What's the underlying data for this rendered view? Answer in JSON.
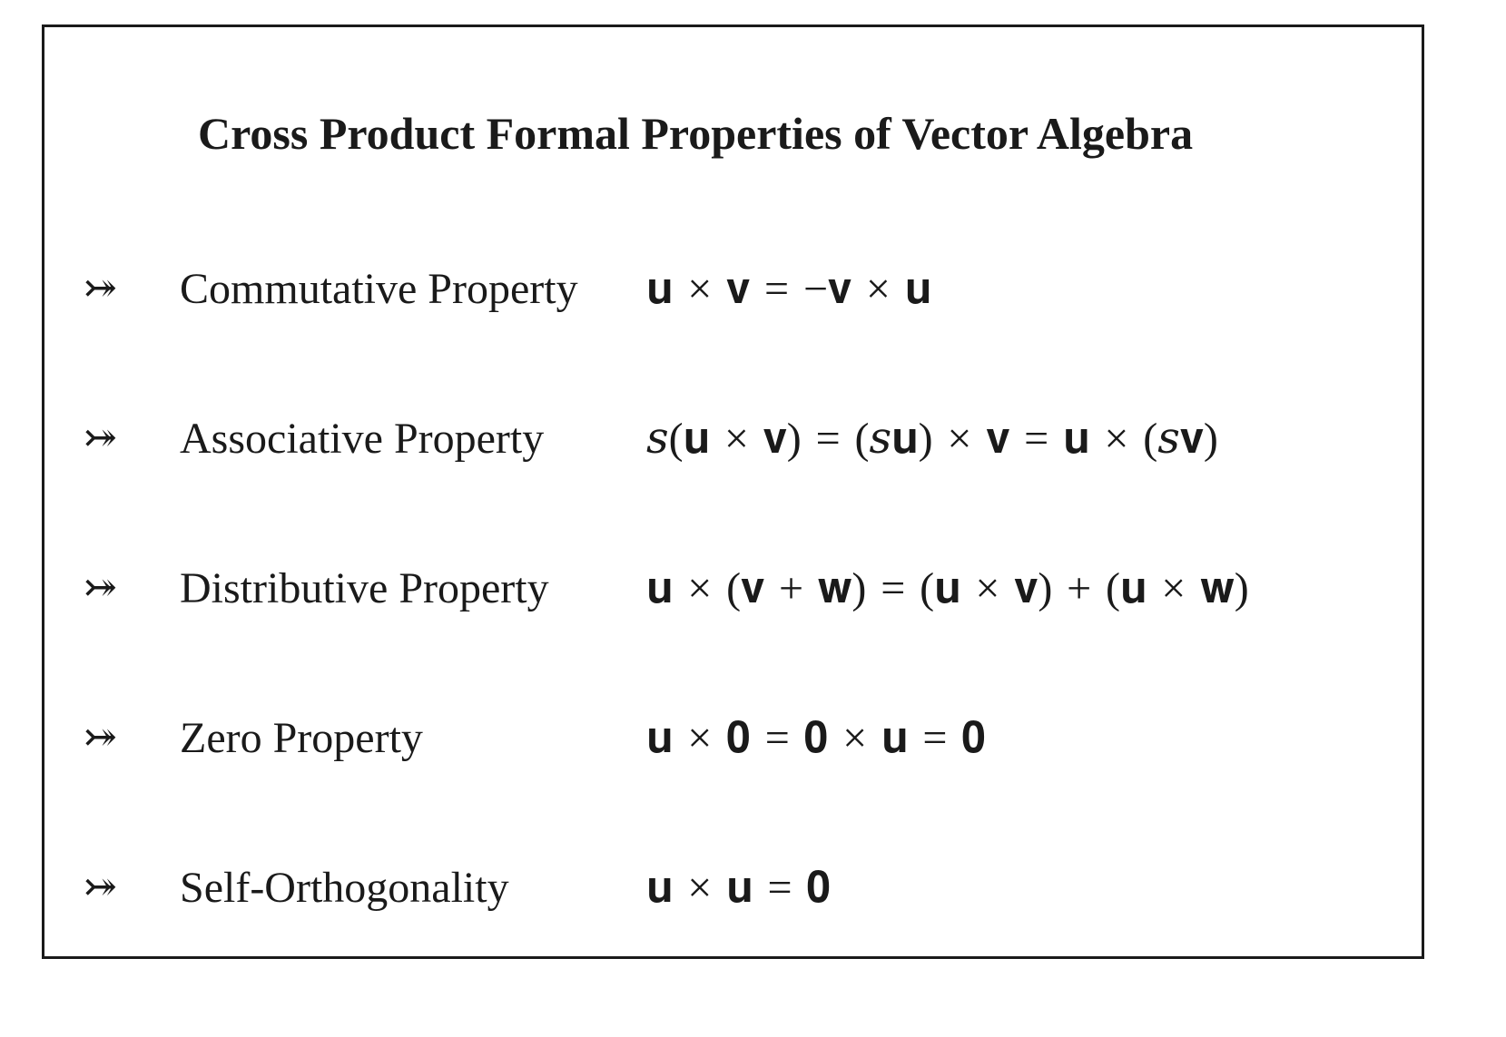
{
  "title": "Cross Product Formal Properties of Vector Algebra",
  "bullet_glyph": "⤖",
  "properties": [
    {
      "label": "Commutative Property",
      "formula": "𝐮 × 𝐯 = −𝐯 × 𝐮"
    },
    {
      "label": "Associative Property",
      "formula": "𝑠(𝐮 × 𝐯) = (𝑠𝐮) × 𝐯 = 𝐮 × (𝑠𝐯)"
    },
    {
      "label": "Distributive Property",
      "formula": "𝐮 × (𝐯 + 𝐰) = (𝐮 × 𝐯) + (𝐮 × 𝐰)"
    },
    {
      "label": "Zero Property",
      "formula": "𝐮 × 𝟎 = 𝟎 × 𝐮 = 𝟎"
    },
    {
      "label": "Self-Orthogonality",
      "formula": "𝐮 × 𝐮 = 𝟎"
    }
  ]
}
